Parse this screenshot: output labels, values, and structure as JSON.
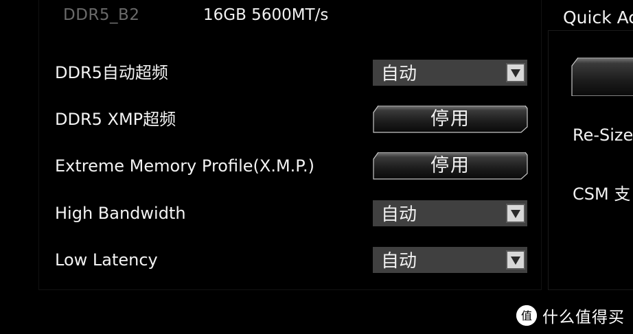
{
  "memory": {
    "slot": "DDR5_B2",
    "info": "16GB 5600MT/s"
  },
  "settings": [
    {
      "label": "DDR5自动超频",
      "control": "dropdown",
      "value": "自动"
    },
    {
      "label": "DDR5 XMP超频",
      "control": "button",
      "value": "停用"
    },
    {
      "label": "Extreme Memory Profile(X.M.P.)",
      "control": "button",
      "value": "停用"
    },
    {
      "label": "High Bandwidth",
      "control": "dropdown",
      "value": "自动"
    },
    {
      "label": "Low Latency",
      "control": "dropdown",
      "value": "自动"
    }
  ],
  "right_panel": {
    "title": "Quick Ac",
    "items": [
      {
        "label": "Re-Size"
      },
      {
        "label": "CSM 支"
      }
    ]
  },
  "watermark": {
    "logo_char": "值",
    "text": "什么值得买"
  },
  "icons": {
    "dropdown_arrow": "triangle-down-icon",
    "logo": "smzdm-logo-icon"
  },
  "colors": {
    "background": "#000000",
    "dropdown_bg": "#404040",
    "label_text": "#f3f3f3",
    "slot_text": "#6a6a6a"
  }
}
